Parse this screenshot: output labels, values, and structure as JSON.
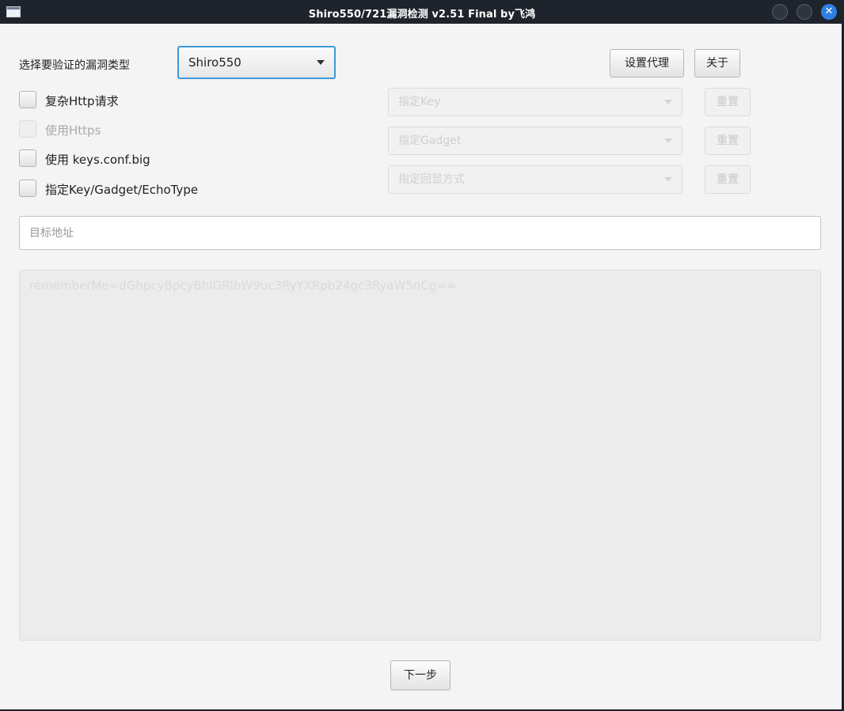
{
  "window": {
    "title": "Shiro550/721漏洞检测 v2.51 Final  by飞鸿",
    "close_glyph": "✕"
  },
  "form": {
    "vuln_type_label": "选择要验证的漏洞类型",
    "vuln_type_value": "Shiro550",
    "proxy_button": "设置代理",
    "about_button": "关于"
  },
  "options": [
    {
      "label": "复杂Http请求",
      "checked": false,
      "enabled": true
    },
    {
      "label": "使用Https",
      "checked": false,
      "enabled": false
    },
    {
      "label": "使用 keys.conf.big",
      "checked": false,
      "enabled": true
    },
    {
      "label": "指定Key/Gadget/EchoType",
      "checked": false,
      "enabled": true
    }
  ],
  "selectors": [
    {
      "placeholder": "指定Key",
      "reset": "重置"
    },
    {
      "placeholder": "指定Gadget",
      "reset": "重置"
    },
    {
      "placeholder": "指定回显方式",
      "reset": "重置"
    }
  ],
  "target": {
    "placeholder": "目标地址",
    "value": ""
  },
  "output": {
    "placeholder": "rememberMe=dGhpcyBpcyBhIGRlbW9uc3RyYXRpb24gc3RyaW5nCg=="
  },
  "footer": {
    "next_button": "下一步"
  },
  "colors": {
    "titlebar": "#1f232b",
    "accent": "#3d9ad6",
    "close": "#2d7fe0",
    "client_bg": "#f4f4f4"
  },
  "icons": [
    "app-window-icon",
    "minimize-icon",
    "maximize-icon",
    "close-icon",
    "chevron-down-icon"
  ]
}
